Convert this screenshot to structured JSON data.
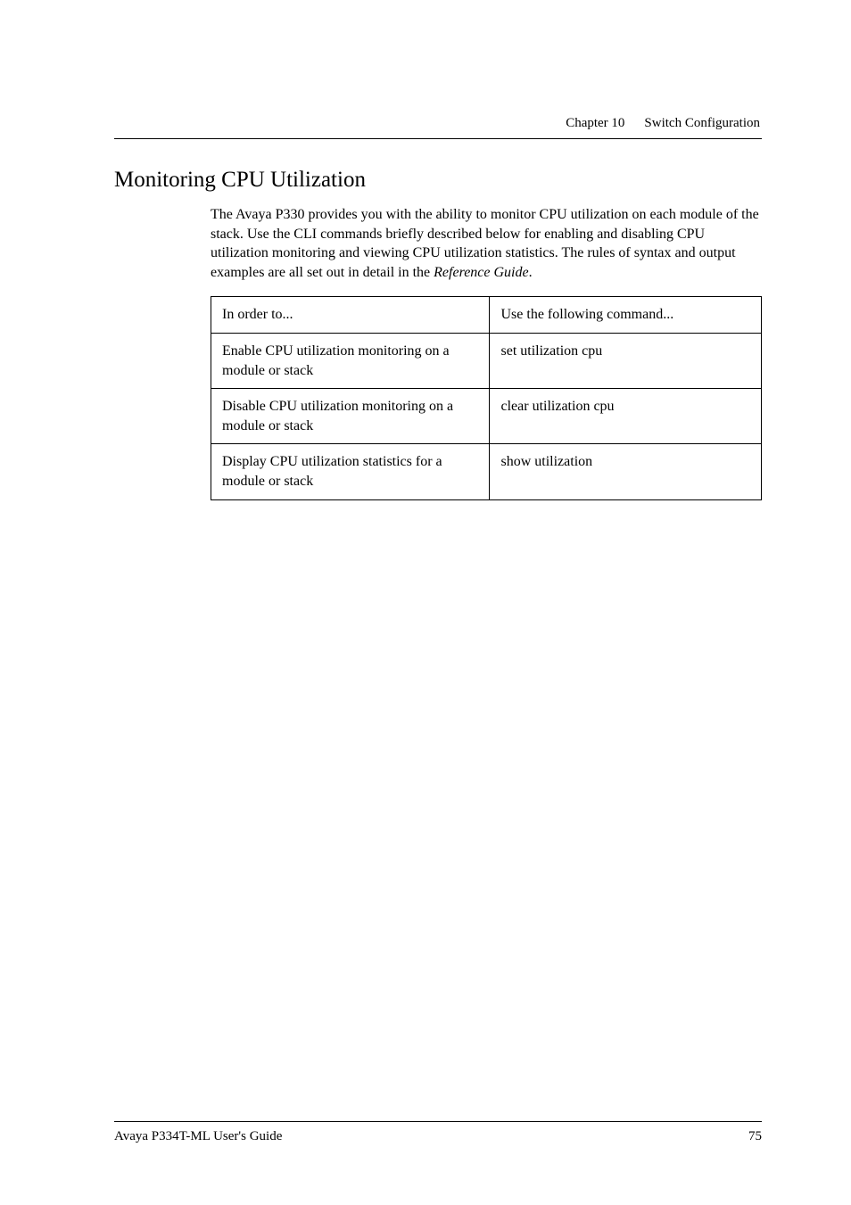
{
  "header": {
    "chapter_label": "Chapter 10",
    "chapter_title": "Switch Configuration"
  },
  "section": {
    "heading": "Monitoring CPU Utilization",
    "paragraph_part1": "The Avaya P330 provides you with the ability to monitor CPU utilization on each module of the stack. Use the CLI commands briefly described below for enabling and disabling CPU utilization monitoring and viewing CPU utilization statistics. The rules of syntax and output examples are all set out in detail in the ",
    "paragraph_italic": "Reference Guide",
    "paragraph_part2": "."
  },
  "table": {
    "header_left": "In order to...",
    "header_right": "Use the following command...",
    "rows": [
      {
        "left": "Enable CPU utilization monitoring on a module or stack",
        "right": "set utilization cpu"
      },
      {
        "left": "Disable CPU utilization monitoring on a module or stack",
        "right": "clear utilization cpu"
      },
      {
        "left": "Display CPU utilization statistics for a module or stack",
        "right": "show utilization"
      }
    ]
  },
  "footer": {
    "guide_name": "Avaya P334T-ML User's Guide",
    "page_number": "75"
  }
}
